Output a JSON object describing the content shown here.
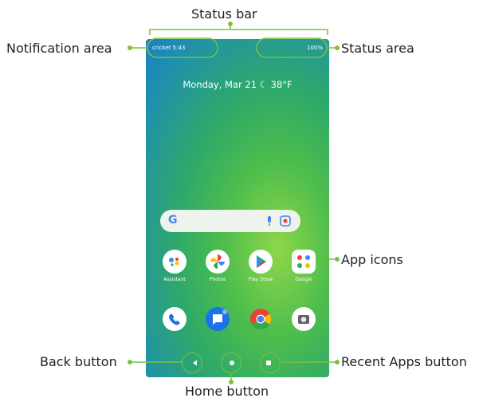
{
  "labels": {
    "status_bar": "Status bar",
    "notification_area": "Notification area",
    "status_area": "Status area",
    "app_icons": "App icons",
    "back_button": "Back button",
    "home_button": "Home button",
    "recent_apps_button": "Recent Apps button"
  },
  "phone": {
    "status_left": "cricket 5:43",
    "status_right": "100%",
    "date_weather": "Monday, Mar 21  ☾ 38°F",
    "search_logo": "G",
    "apps": [
      {
        "name": "Assistant",
        "icon": "assistant-icon"
      },
      {
        "name": "Photos",
        "icon": "photos-icon"
      },
      {
        "name": "Play Store",
        "icon": "play-store-icon"
      },
      {
        "name": "Google",
        "icon": "google-folder-icon"
      }
    ],
    "dock": [
      {
        "icon": "phone-icon"
      },
      {
        "icon": "messages-icon"
      },
      {
        "icon": "chrome-icon"
      },
      {
        "icon": "camera-icon"
      }
    ]
  },
  "colors": {
    "callout": "#7ac142",
    "wallpaper_top": "#1a7fc4",
    "wallpaper_mid": "#2ea86b",
    "wallpaper_bright": "#8fd64a"
  }
}
